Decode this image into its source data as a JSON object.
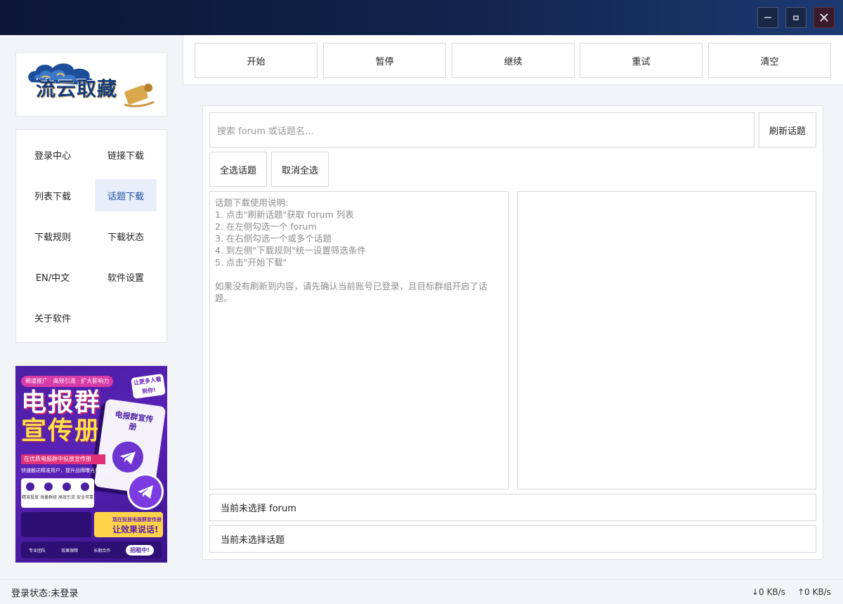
{
  "window": {
    "controls": {
      "minimize": "minimize-icon",
      "maximize": "maximize-icon",
      "close": "close-icon"
    }
  },
  "brand": {
    "logo_text": "流云取藏"
  },
  "sidebar": {
    "items": [
      {
        "label": "登录中心",
        "active": false
      },
      {
        "label": "链接下载",
        "active": false
      },
      {
        "label": "列表下载",
        "active": false
      },
      {
        "label": "话题下载",
        "active": true
      },
      {
        "label": "下载规则",
        "active": false
      },
      {
        "label": "下载状态",
        "active": false
      },
      {
        "label": "EN/中文",
        "active": false
      },
      {
        "label": "软件设置",
        "active": false
      },
      {
        "label": "关于软件",
        "active": false
      }
    ]
  },
  "ad": {
    "pill": "频道推广 · 高效引流 · 扩大影响力",
    "title_line1": "电报群",
    "title_line2": "宣传册",
    "badge": "让更多人看到你!",
    "book_title": "电报群宣传册",
    "red_strip": "在优质电报群中投放宣传册",
    "subtitle": "快速触达精准用户，提升品牌曝光与转化!",
    "features": [
      "精准投放",
      "海量群组",
      "高效引流",
      "安全可靠"
    ],
    "gold_line1": "现在投放电报群宣传册",
    "gold_line2": "让效果说话!",
    "bottom": [
      "专业团队",
      "效果保障",
      "长期合作"
    ],
    "cta": "招租中!"
  },
  "toolbar": {
    "buttons": [
      "开始",
      "暂停",
      "继续",
      "重试",
      "清空"
    ]
  },
  "main": {
    "search_placeholder": "搜索 forum 或话题名...",
    "refresh_label": "刷新话题",
    "select_all_label": "全选话题",
    "deselect_all_label": "取消全选",
    "instructions": "话题下载使用说明:\n1. 点击\"刷新话题\"获取 forum 列表\n2. 在左侧勾选一个 forum\n3. 在右侧勾选一个或多个话题\n4. 到左侧\"下载规则\"统一设置筛选条件\n5. 点击\"开始下载\"\n\n如果没有刷新到内容，请先确认当前账号已登录，且目标群组开启了话题。",
    "forum_status": "当前未选择 forum",
    "topic_status": "当前未选择话题"
  },
  "statusbar": {
    "login_status": "登录状态:未登录",
    "download_speed": "↓0 KB/s",
    "upload_speed": "↑0 KB/s"
  }
}
